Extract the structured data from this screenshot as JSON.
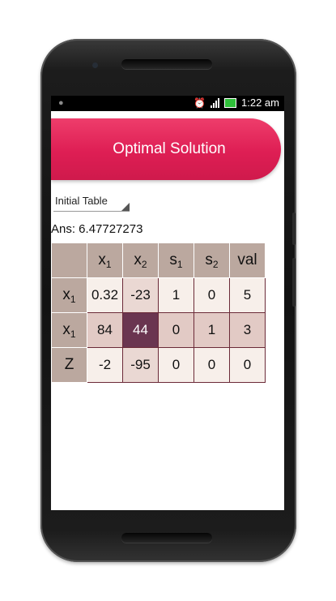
{
  "status_bar": {
    "android_icon": "android-icon",
    "alarm_icon": "alarm-clock-icon",
    "signal_icon": "signal-icon",
    "battery_icon": "battery-icon",
    "time": "1:22 am"
  },
  "title": "Optimal Solution",
  "spinner": {
    "selected": "Initial Table"
  },
  "answer": "Ans: 6.47727273",
  "table": {
    "col_headers": [
      {
        "base": "x",
        "sub": "1"
      },
      {
        "base": "x",
        "sub": "2"
      },
      {
        "base": "s",
        "sub": "1"
      },
      {
        "base": "s",
        "sub": "2"
      },
      {
        "base": "val",
        "sub": ""
      }
    ],
    "rows": [
      {
        "head_base": "x",
        "head_sub": "1",
        "cells": [
          "0.32",
          "-23",
          "1",
          "0",
          "5"
        ]
      },
      {
        "head_base": "x",
        "head_sub": "1",
        "cells": [
          "84",
          "44",
          "0",
          "1",
          "3"
        ]
      },
      {
        "head_base": "Z",
        "head_sub": "",
        "cells": [
          "-2",
          "-95",
          "0",
          "0",
          "0"
        ]
      }
    ]
  },
  "colors": {
    "title_bar": "#de1e54",
    "header_cells": "#bba89f",
    "pivot_cell": "#6a3550"
  }
}
